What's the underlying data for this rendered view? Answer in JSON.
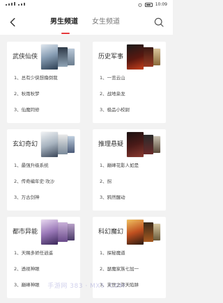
{
  "status_bar": {
    "time": "10:09"
  },
  "nav": {
    "tabs": [
      {
        "label": "男生频道",
        "active": true
      },
      {
        "label": "女生频道",
        "active": false
      }
    ]
  },
  "cards": [
    {
      "title": "武侠仙侠",
      "items": [
        "1、总有少侠想撸倒我",
        "2、秋雨秋梦",
        "3、仙魔同修"
      ]
    },
    {
      "title": "历史军事",
      "items": [
        "1、一览云山",
        "2、战地枭龙",
        "3、极品小校尉"
      ]
    },
    {
      "title": "玄幻奇幻",
      "items": [
        "1、最强升级系统",
        "2、传奇编年史·攻沙",
        "3、万古剑神"
      ]
    },
    {
      "title": "推理悬疑",
      "items": [
        "1、巅峰花影人如是",
        "2、拐",
        "3、鸦然醒动"
      ]
    },
    {
      "title": "都市异能",
      "items": [
        "1、天赐多娇任逍遥",
        "2、透视神眼",
        "3、巅峰神眼"
      ]
    },
    {
      "title": "科幻魔幻",
      "items": [
        "1、探秘魔道",
        "2、瑟魔家族七加一",
        "3、末世之弥天陷阱"
      ]
    }
  ],
  "colors": {
    "accent": "#e5383b",
    "background": "#f2f2f2"
  },
  "watermark": "手游网 383 · MX5 .COM"
}
